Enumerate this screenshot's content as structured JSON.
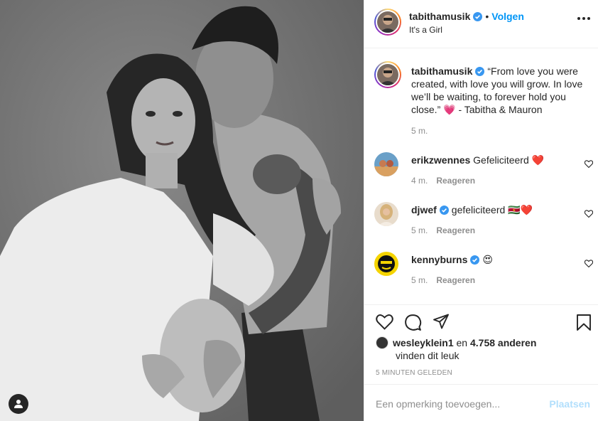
{
  "post": {
    "username": "tabithamusik",
    "follow_label": "Volgen",
    "separator": "•",
    "location": "It's a Girl",
    "caption": "“From love you were created, with love you will grow. In love we’ll be waiting, to forever hold you close.” 💗 - Tabitha & Mauron",
    "caption_time": "5 m."
  },
  "comments": [
    {
      "username": "erikzwennes",
      "text": "Gefeliciteerd ❤️",
      "time": "4 m.",
      "reply_label": "Reageren",
      "verified": false
    },
    {
      "username": "djwef",
      "text": "gefeliciteerd 🇸🇷❤️",
      "time": "5 m.",
      "reply_label": "Reageren",
      "verified": true
    },
    {
      "username": "kennyburns",
      "text": "😍",
      "time": "5 m.",
      "reply_label": "Reageren",
      "verified": true
    }
  ],
  "likes": {
    "user": "wesleyklein1",
    "connector": "en",
    "count_text": "4.758 anderen",
    "suffix": "vinden dit leuk"
  },
  "timestamp": "5 MINUTEN GELEDEN",
  "add_comment": {
    "placeholder": "Een opmerking toevoegen...",
    "post_label": "Plaatsen"
  },
  "colors": {
    "link_blue": "#0095f6",
    "verified_blue": "#3897f0",
    "post_disabled": "#b2dffc",
    "meta_grey": "#8e8e8e"
  },
  "icons": [
    "user-tag-icon",
    "more-options-icon",
    "heart-icon",
    "comment-icon",
    "share-icon",
    "bookmark-icon",
    "verified-badge-icon"
  ]
}
